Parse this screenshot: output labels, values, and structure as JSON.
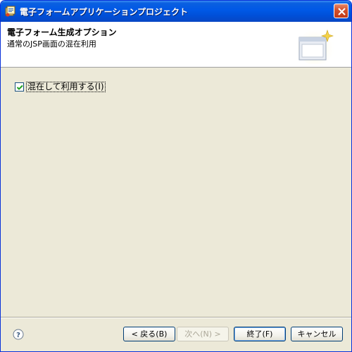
{
  "window": {
    "title": "電子フォームアプリケーションプロジェクト",
    "icon": "wizard-app-icon",
    "close_icon": "close-icon"
  },
  "header": {
    "title": "電子フォーム生成オプション",
    "description": "通常のJSP画面の混在利用",
    "graphic": "wizard-banner-icon"
  },
  "options": {
    "mix_use": {
      "label": "混在して利用する(I)",
      "checked": true
    }
  },
  "footer": {
    "help_icon": "help-icon",
    "back_label": "< 戻る(B)",
    "next_label": "次へ(N) >",
    "finish_label": "終了(F)",
    "cancel_label": "キャンセル"
  },
  "colors": {
    "titlebar": "#0058e6",
    "dialog_bg": "#ece9d8",
    "header_bg": "#ffffff",
    "button_border": "#003c74"
  }
}
